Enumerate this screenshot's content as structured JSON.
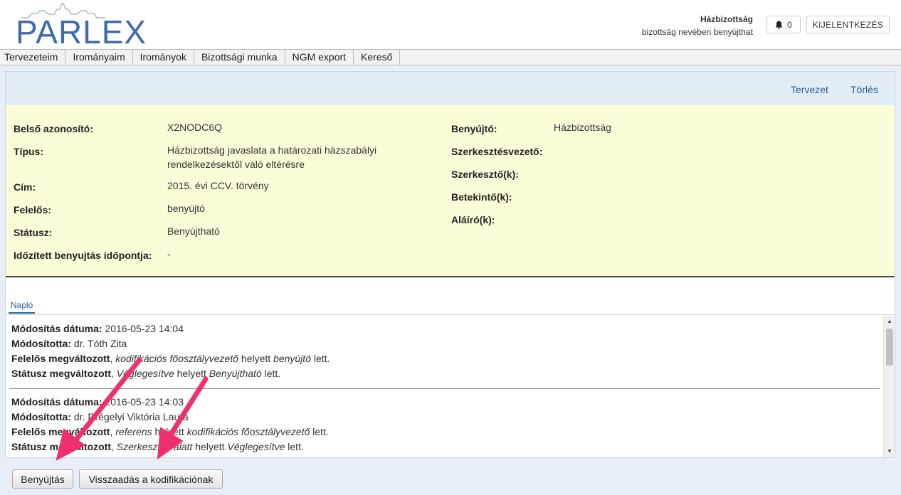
{
  "header": {
    "logo_text": "PARLEX",
    "user_name": "Házbizottság",
    "user_subtitle": "bizottság nevében benyújthat",
    "notification_count": "0",
    "logout_label": "KIJELENTKEZÉS"
  },
  "menu": [
    "Tervezeteim",
    "Irományaim",
    "Irományok",
    "Bizottsági munka",
    "NGM export",
    "Kereső"
  ],
  "actions": {
    "draft": "Tervezet",
    "delete": "Törlés"
  },
  "details": {
    "left": [
      {
        "label": "Belső azonosító:",
        "value": "X2NODC6Q"
      },
      {
        "label": "Típus:",
        "value": "Házbizottság javaslata a határozati házszabályi rendelkezésektől való eltérésre"
      },
      {
        "label": "Cím:",
        "value": "2015. évi CCV. törvény"
      },
      {
        "label": "Felelős:",
        "value": "benyújtó"
      },
      {
        "label": "Státusz:",
        "value": "Benyújtható"
      },
      {
        "label": "Időzített benyujtás időpontja:",
        "value": "-"
      }
    ],
    "right": [
      {
        "label": "Benyújtó:",
        "value": "Házbizottság"
      },
      {
        "label": "Szerkesztésvezető:",
        "value": ""
      },
      {
        "label": "Szerkesztő(k):",
        "value": ""
      },
      {
        "label": "Betekintő(k):",
        "value": ""
      },
      {
        "label": "Aláíró(k):",
        "value": ""
      }
    ]
  },
  "tab_label": "Napló",
  "log_labels": {
    "date": "Módosítás dátuma:",
    "by": "Módosította:",
    "resp": "Felelős megváltozott",
    "status": "Státusz megváltozott",
    "instead": "helyett",
    "became": "lett."
  },
  "log": [
    {
      "date": "2016-05-23 14:04",
      "by": "dr. Tóth Zita",
      "resp_old": "kodifikációs főosztályvezető",
      "resp_new": "benyújtó",
      "status_old": "Véglegesítve",
      "status_new": "Benyújtható"
    },
    {
      "date": "2016-05-23 14:03",
      "by": "dr. Drégelyi Viktória Laura",
      "resp_old": "referens",
      "resp_new": "kodifikációs főosztályvezető",
      "status_old": "Szerkesztés alatt",
      "status_new": "Véglegesítve"
    }
  ],
  "buttons": {
    "submit": "Benyújtás",
    "return": "Visszaadás a kodifikációnak"
  },
  "colors": {
    "brand": "#3e6bab",
    "details_bg": "#fcfcd9",
    "annotation_arrow": "#f0306e"
  }
}
